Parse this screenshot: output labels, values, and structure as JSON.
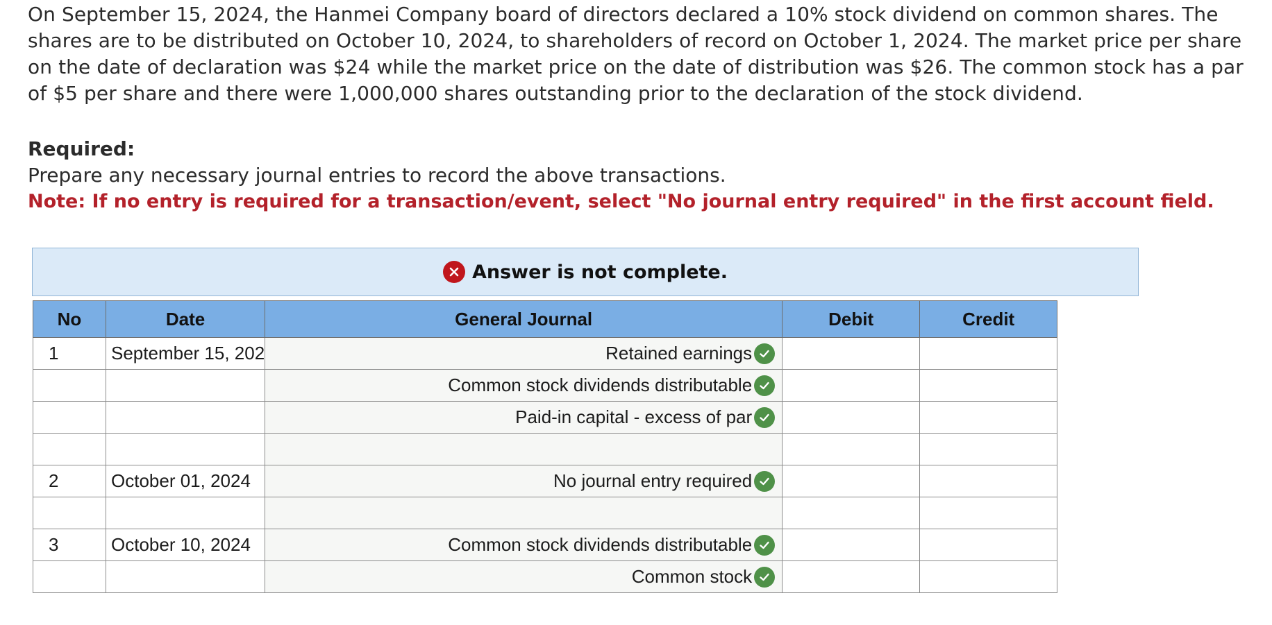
{
  "problem": {
    "text": "On September 15, 2024, the Hanmei Company board of directors declared a 10% stock dividend on common shares. The shares are to be distributed on October 10, 2024, to shareholders of record on October 1, 2024. The market price per share on the date of declaration was $24 while the market price on the date of distribution was $26. The common stock has a par of $5 per share and there were 1,000,000 shares outstanding prior to the declaration of the stock dividend."
  },
  "required": {
    "title": "Required:",
    "instructions": "Prepare any necessary journal entries to record the above transactions.",
    "note": "Note: If no entry is required for a transaction/event, select \"No journal entry required\" in the first account field."
  },
  "banner": {
    "status_icon": "x-circle-icon",
    "text": "Answer is not complete.",
    "background_color": "#dbeaf8",
    "error_color": "#c0161c"
  },
  "table": {
    "header_color": "#7aaee4",
    "check_color": "#4f9148",
    "headers": {
      "no": "No",
      "date": "Date",
      "general_journal": "General Journal",
      "debit": "Debit",
      "credit": "Credit"
    },
    "rows": [
      {
        "no": "1",
        "date": "September 15, 202",
        "account": "Retained earnings",
        "correct": true,
        "debit": "",
        "credit": ""
      },
      {
        "no": "",
        "date": "",
        "account": "Common stock dividends distributable",
        "correct": true,
        "debit": "",
        "credit": ""
      },
      {
        "no": "",
        "date": "",
        "account": "Paid-in capital - excess of par",
        "correct": true,
        "debit": "",
        "credit": ""
      },
      {
        "no": "",
        "date": "",
        "account": "",
        "correct": false,
        "debit": "",
        "credit": ""
      },
      {
        "no": "2",
        "date": "October 01, 2024",
        "account": "No journal entry required",
        "correct": true,
        "debit": "",
        "credit": ""
      },
      {
        "no": "",
        "date": "",
        "account": "",
        "correct": false,
        "debit": "",
        "credit": ""
      },
      {
        "no": "3",
        "date": "October 10, 2024",
        "account": "Common stock dividends distributable",
        "correct": true,
        "debit": "",
        "credit": ""
      },
      {
        "no": "",
        "date": "",
        "account": "Common stock",
        "correct": true,
        "debit": "",
        "credit": ""
      }
    ]
  }
}
